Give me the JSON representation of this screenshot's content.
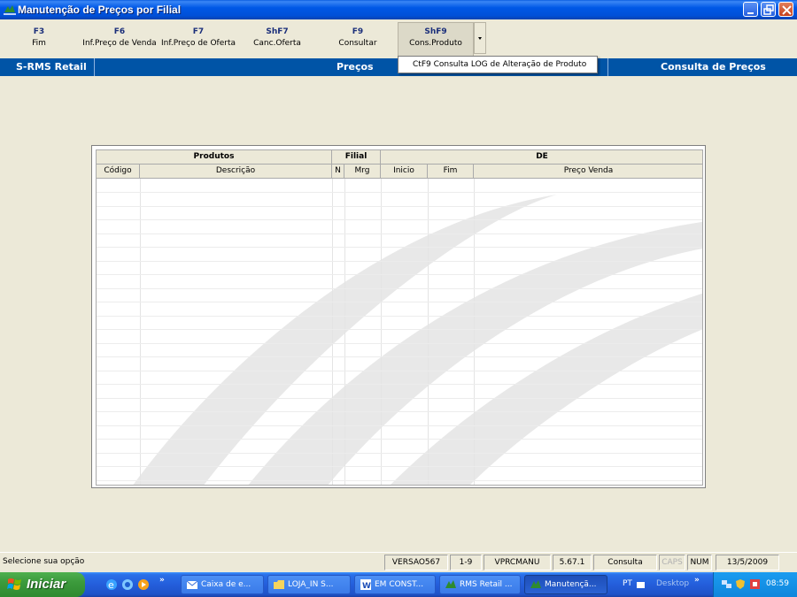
{
  "window": {
    "title": "Manutenção de Preços por Filial"
  },
  "toolbar": {
    "keys": [
      {
        "key": "F3",
        "label": "Fim"
      },
      {
        "key": "F6",
        "label": "Inf.Preço de Venda"
      },
      {
        "key": "F7",
        "label": "Inf.Preço de Oferta"
      },
      {
        "key": "ShF7",
        "label": "Canc.Oferta"
      },
      {
        "key": "F9",
        "label": "Consultar"
      },
      {
        "key": "ShF9",
        "label": "Cons.Produto"
      }
    ]
  },
  "popup": {
    "item": "CtF9  Consulta LOG de Alteração de Produto"
  },
  "band": {
    "left": "S-RMS Retail",
    "center": "Preços",
    "right": "Consulta de Preços"
  },
  "grid": {
    "groups": [
      "Produtos",
      "Filial",
      "DE"
    ],
    "columns": [
      "Código",
      "Descrição",
      "N",
      "Mrg",
      "Inicio",
      "Fim",
      "Preço Venda"
    ]
  },
  "statusbar": {
    "message": "Selecione sua opção",
    "version": "VERSAO567",
    "page": "1-9",
    "program": "VPRCMANU",
    "build": "5.67.1",
    "mode": "Consulta",
    "caps": "CAPS",
    "num": "NUM",
    "date": "13/5/2009"
  },
  "taskbar": {
    "start": "Iniciar",
    "buttons": [
      "Caixa de e...",
      "LOJA_IN S...",
      "EM CONST...",
      "RMS Retail ...",
      "Manutençã..."
    ],
    "lang": "PT",
    "desktop": "Desktop",
    "clock": "08:59"
  },
  "colors": {
    "title_bar": "#0058e6",
    "band": "#0054a6",
    "taskbar": "#245edb",
    "start": "#3c9a3c"
  }
}
